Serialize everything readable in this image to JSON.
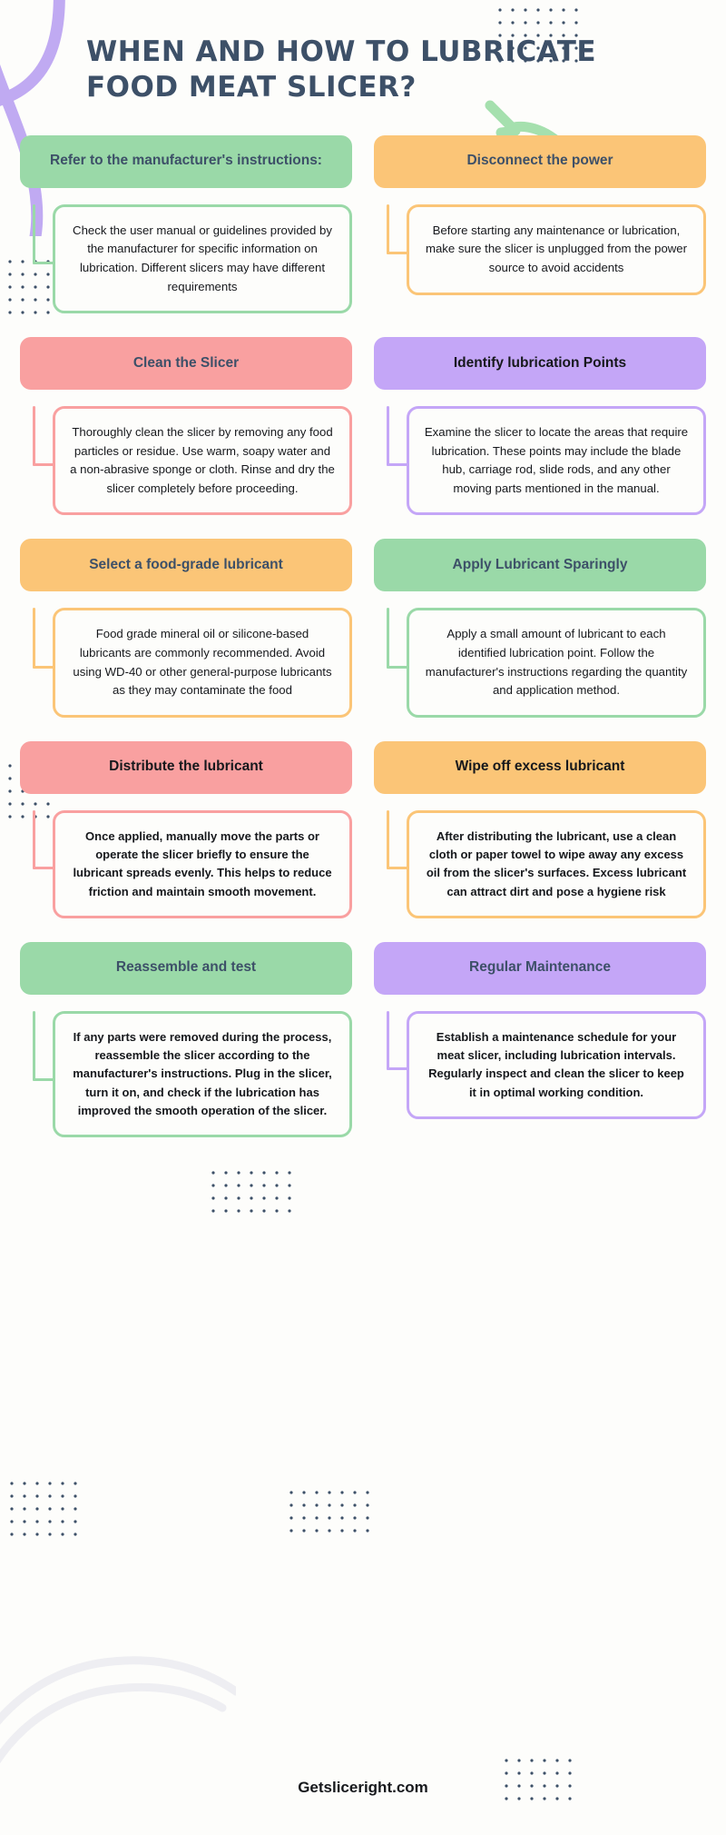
{
  "title": "WHEN AND HOW TO LUBRICATE FOOD MEAT SLICER?",
  "footer": "Getsliceright.com",
  "palette": {
    "green": "#9ad9a8",
    "orange": "#fbc577",
    "red": "#f9a0a0",
    "purple": "#c4a6f7",
    "title_text": "#3d5068",
    "body_text": "#16181c",
    "background": "#fdfdfb",
    "dot_color": "#3d5068"
  },
  "steps": [
    {
      "title": "Refer to the manufacturer's instructions:",
      "body": "Check the user manual or guidelines provided by the manufacturer for specific information on lubrication. Different slicers may have different requirements",
      "color": "green",
      "title_style": "slate",
      "body_weight": "normal"
    },
    {
      "title": "Disconnect the power",
      "body": "Before starting any maintenance or lubrication, make sure the slicer is unplugged from the power source to avoid accidents",
      "color": "orange",
      "title_style": "slate",
      "body_weight": "normal"
    },
    {
      "title": "Clean the Slicer",
      "body": "Thoroughly clean the slicer by removing any food particles or residue. Use warm, soapy water and a non-abrasive sponge or cloth. Rinse and dry the slicer completely before proceeding.",
      "color": "red",
      "title_style": "slate",
      "body_weight": "normal"
    },
    {
      "title": "Identify lubrication Points",
      "body": "Examine the slicer to locate the areas that require lubrication. These points may include the blade hub, carriage rod, slide rods, and any other moving parts mentioned in the manual.",
      "color": "purple",
      "title_style": "dark",
      "body_weight": "normal"
    },
    {
      "title": "Select a food-grade lubricant",
      "body": "Food grade mineral oil or silicone-based lubricants are commonly recommended. Avoid using WD-40 or other general-purpose lubricants as they may contaminate the food",
      "color": "orange",
      "title_style": "slate",
      "body_weight": "normal"
    },
    {
      "title": "Apply Lubricant Sparingly",
      "body": "Apply a small amount of lubricant to each identified lubrication point. Follow the manufacturer's instructions regarding the quantity and application method.",
      "color": "green",
      "title_style": "slate",
      "body_weight": "normal"
    },
    {
      "title": "Distribute the lubricant",
      "body": "Once applied, manually move the parts or operate the slicer briefly to ensure the lubricant spreads evenly. This helps to reduce friction and maintain smooth movement.",
      "color": "red",
      "title_style": "dark",
      "body_weight": "bold"
    },
    {
      "title": "Wipe off excess lubricant",
      "body": "After distributing the lubricant, use a clean cloth or paper towel to wipe away any excess oil from the slicer's surfaces. Excess lubricant can attract dirt and pose a hygiene risk",
      "color": "orange",
      "title_style": "dark",
      "body_weight": "bold"
    },
    {
      "title": "Reassemble and test",
      "body": "If any parts were removed during the process, reassemble the slicer according to the manufacturer's instructions. Plug in the slicer, turn it on, and check if the lubrication has improved the smooth operation of the slicer.",
      "color": "green",
      "title_style": "slate",
      "body_weight": "bold"
    },
    {
      "title": "Regular Maintenance",
      "body": "Establish a maintenance schedule for your meat slicer, including lubrication intervals. Regularly inspect and clean the slicer to keep it in optimal working condition.",
      "color": "purple",
      "title_style": "slate",
      "body_weight": "bold"
    }
  ],
  "decorations": {
    "swirl_purple": "purple-curve-shape",
    "swirl_green_arrow": "green-arrow-shape",
    "swirl_bottom": "light-curve-shape",
    "dot_grids": 9
  }
}
